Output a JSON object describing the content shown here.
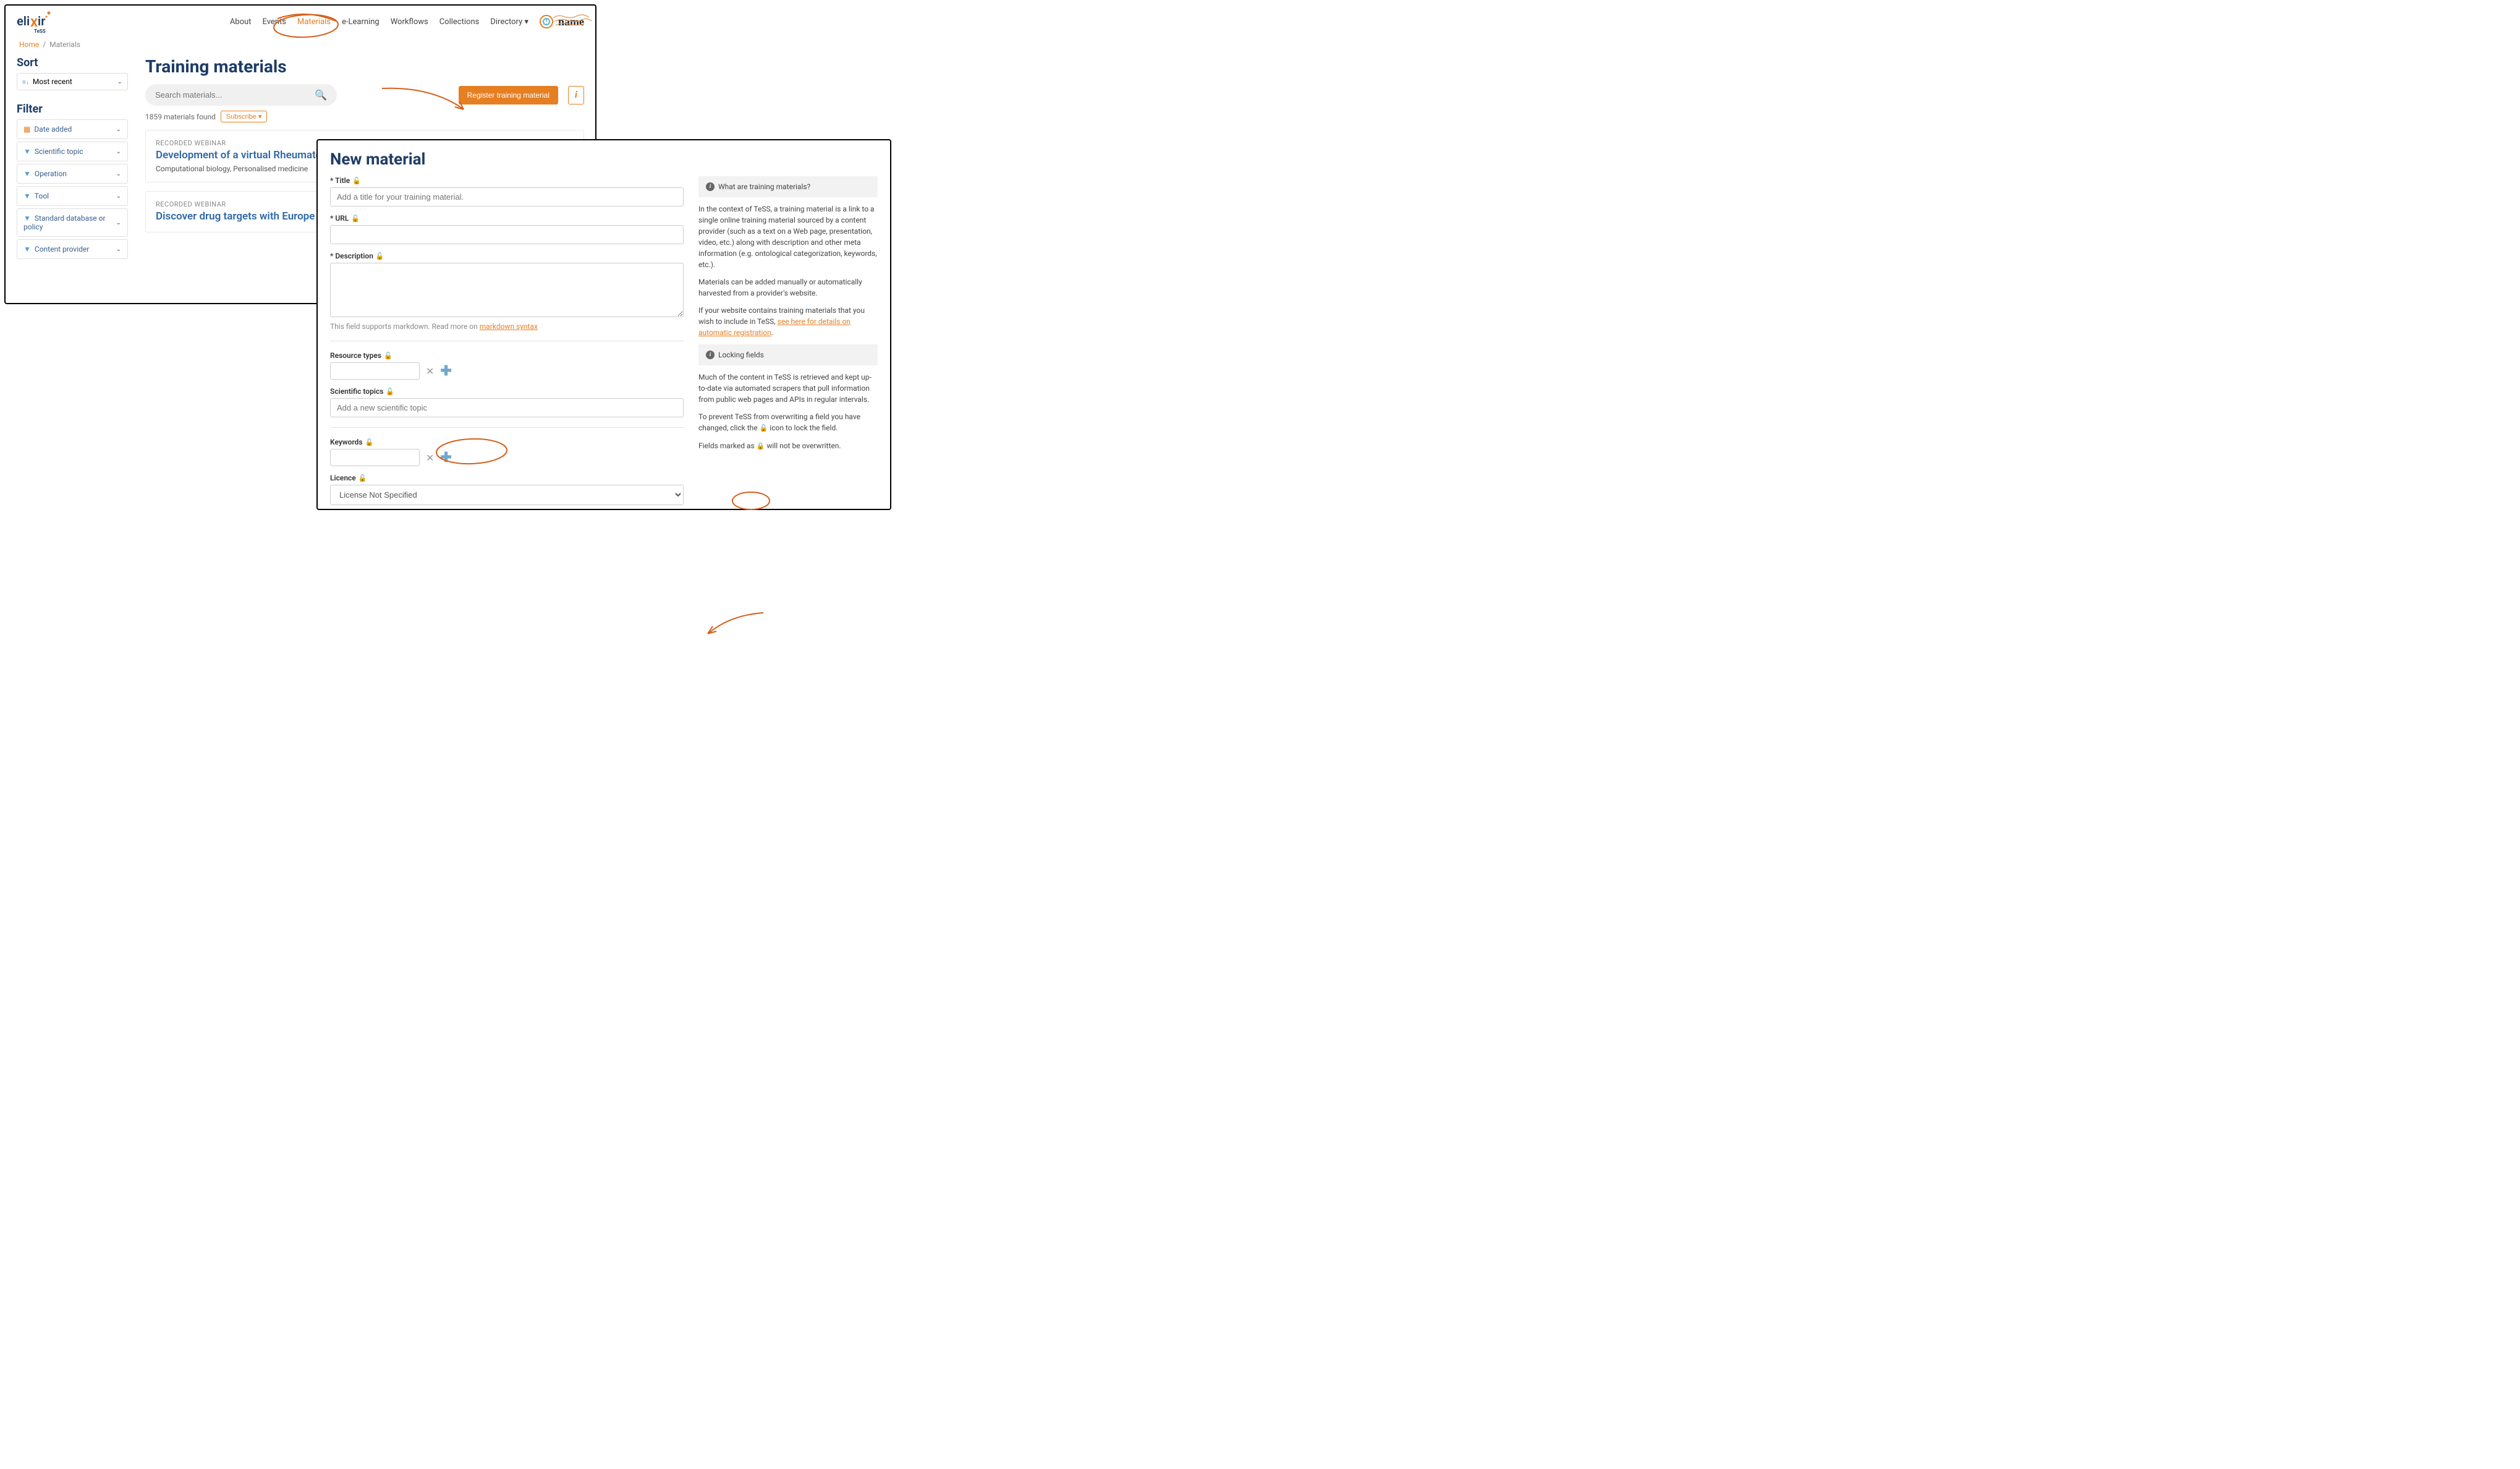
{
  "logo_text": "elixir",
  "logo_sub": "TeSS",
  "nav": {
    "about": "About",
    "events": "Events",
    "materials": "Materials",
    "elearning": "e-Learning",
    "workflows": "Workflows",
    "collections": "Collections",
    "directory": "Directory"
  },
  "user_name": "name",
  "breadcrumb": {
    "home": "Home",
    "current": "Materials"
  },
  "sort": {
    "heading": "Sort",
    "selected": "Most recent"
  },
  "filter": {
    "heading": "Filter",
    "date_added": "Date added",
    "scientific_topic": "Scientific topic",
    "operation": "Operation",
    "tool": "Tool",
    "standard": "Standard database or policy",
    "content_provider": "Content provider"
  },
  "main": {
    "heading": "Training materials",
    "search_placeholder": "Search materials...",
    "register_btn": "Register training material",
    "count_text": "1859 materials found",
    "subscribe": "Subscribe"
  },
  "cards": [
    {
      "eyebrow": "RECORDED WEBINAR",
      "title": "Development of a virtual Rheumatoid analysis and efficient drug-target ide",
      "tags": "Computational biology, Personalised medicine"
    },
    {
      "eyebrow": "RECORDED WEBINAR",
      "title": "Discover drug targets with Europe P",
      "tags": ""
    }
  ],
  "form": {
    "heading": "New material",
    "title_label": "* Title",
    "title_placeholder": "Add a title for your training material.",
    "url_label": "* URL",
    "desc_label": "* Description",
    "desc_help_prefix": "This field supports markdown. Read more on ",
    "desc_help_link": "markdown syntax",
    "resource_types": "Resource types",
    "scientific_topics": "Scientific topics",
    "scientific_placeholder": "Add a new scientific topic",
    "keywords": "Keywords",
    "licence": "Licence",
    "licence_selected": "License Not Specified"
  },
  "sidebar2": {
    "panel1_title": "What are training materials?",
    "para1": "In the context of TeSS, a training material is a link to a single online training material sourced by a content provider (such as a text on a Web page, presentation, video, etc.) along with description and other meta information (e.g. ontological categorization, keywords, etc.).",
    "para2": "Materials can be added manually or automatically harvested from a provider's website.",
    "para3_prefix": "If your website contains training materials that you wish to include in TeSS, ",
    "para3_link": "see here for details on automatic registration",
    "panel2_title": "Locking fields",
    "para4": "Much of the content in TeSS is retrieved and kept up-to-date via automated scrapers that pull information from public web pages and APIs in regular intervals.",
    "para5_prefix": "To prevent TeSS from overwriting a field you have changed, click the ",
    "para5_suffix": " icon to lock the field.",
    "para6_prefix": "Fields marked as ",
    "para6_suffix": " will not be overwritten."
  }
}
